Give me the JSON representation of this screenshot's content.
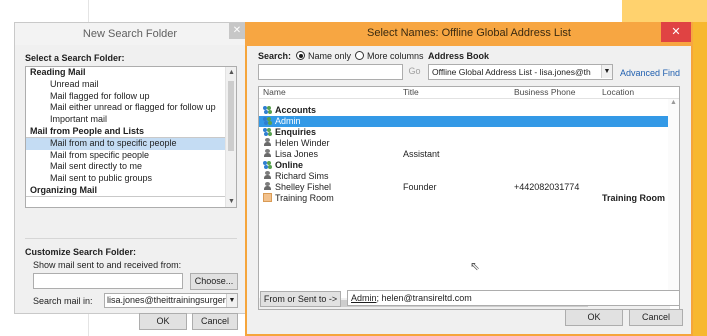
{
  "new_search_folder": {
    "title": "New Search Folder",
    "close_glyph": "✕",
    "select_label": "Select a Search Folder:",
    "list_items": [
      {
        "label": "Reading Mail",
        "type": "category"
      },
      {
        "label": "Unread mail",
        "type": "item"
      },
      {
        "label": "Mail flagged for follow up",
        "type": "item"
      },
      {
        "label": "Mail either unread or flagged for follow up",
        "type": "item"
      },
      {
        "label": "Important mail",
        "type": "item"
      },
      {
        "label": "Mail from People and Lists",
        "type": "category"
      },
      {
        "label": "Mail from and to specific people",
        "type": "item",
        "selected": true
      },
      {
        "label": "Mail from specific people",
        "type": "item"
      },
      {
        "label": "Mail sent directly to me",
        "type": "item"
      },
      {
        "label": "Mail sent to public groups",
        "type": "item"
      },
      {
        "label": "Organizing Mail",
        "type": "category"
      }
    ],
    "customize_label": "Customize Search Folder:",
    "show_mail_label": "Show mail sent to and received from:",
    "show_mail_value": "",
    "choose_button": "Choose...",
    "search_in_label": "Search mail in:",
    "search_in_value": "lisa.jones@theittrainingsurgery.com",
    "ok_button": "OK",
    "cancel_button": "Cancel"
  },
  "select_names": {
    "title": "Select Names: Offline Global Address List",
    "close_glyph": "✕",
    "search_label": "Search:",
    "radio_name_only": "Name only",
    "radio_more_columns": "More columns",
    "search_mode": "Name only",
    "address_book_label": "Address Book",
    "name_input_value": "",
    "go_button": "Go",
    "address_book_value": "Offline Global Address List - lisa.jones@th",
    "advanced_find": "Advanced Find",
    "columns": {
      "name": "Name",
      "title": "Title",
      "phone": "Business Phone",
      "location": "Location"
    },
    "rows": [
      {
        "name": "Accounts",
        "title": "",
        "phone": "",
        "location": "",
        "icon": "group-icon",
        "group": true
      },
      {
        "name": "Admin",
        "title": "",
        "phone": "",
        "location": "",
        "icon": "group-icon",
        "selected": true
      },
      {
        "name": "Enquiries",
        "title": "",
        "phone": "",
        "location": "",
        "icon": "group-icon",
        "group": true
      },
      {
        "name": "Helen Winder",
        "title": "",
        "phone": "",
        "location": "",
        "icon": "user-icon"
      },
      {
        "name": "Lisa Jones",
        "title": "Assistant",
        "phone": "",
        "location": "",
        "icon": "user-icon"
      },
      {
        "name": "Online",
        "title": "",
        "phone": "",
        "location": "",
        "icon": "group-icon",
        "group": true
      },
      {
        "name": "Richard Sims",
        "title": "",
        "phone": "",
        "location": "",
        "icon": "user-icon"
      },
      {
        "name": "Shelley Fishel",
        "title": "Founder",
        "phone": "+442082031774",
        "location": "",
        "icon": "user-icon"
      },
      {
        "name": "Training Room",
        "title": "",
        "phone": "",
        "location": "Training Room",
        "icon": "room-icon"
      }
    ],
    "from_button": "From or Sent to ->",
    "from_value_link": "Admin",
    "from_value_rest": "; helen@transireltd.com",
    "ok_button": "OK",
    "cancel_button": "Cancel"
  },
  "colors": {
    "title_bar_accent": "#f7a642",
    "close_button": "#e04343",
    "selection": "#3399e6",
    "list_selection": "#c4dcf3",
    "link": "#2261b0"
  }
}
